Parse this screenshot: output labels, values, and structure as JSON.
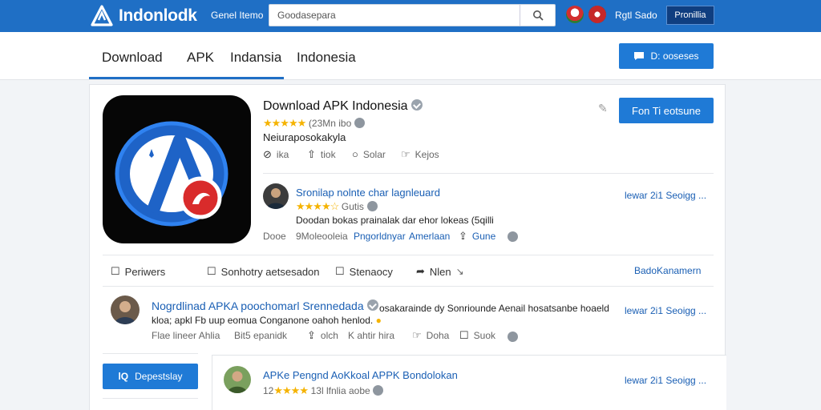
{
  "header": {
    "logo_text": "Indonlodk",
    "nav_label": "Genel Itemo",
    "search_placeholder": "Goodasepara",
    "signin_label": "Rgtl Sado",
    "cta_label": "Pronillia",
    "brand_color": "#1f6fc5"
  },
  "tabs": {
    "items": [
      "Download",
      "APK",
      "Indansia",
      "Indonesia"
    ],
    "action_label": "D: ooseses"
  },
  "app": {
    "title": "Download APK Indonesia",
    "rating_count": "(23Mn ibo",
    "description": "Neiuraposokakyla",
    "actions": [
      "ika",
      "tiok",
      "Solar",
      "Kejos"
    ],
    "download_label": "Fon Ti eotsune"
  },
  "reviewer1": {
    "name": "Sronilap nolnte char lagnleuard",
    "rating_text": "Gutis",
    "review": "Doodan bokas prainalak dar ehor lokeas (5qilli",
    "meta": [
      "Dooe",
      "9Moleooleia"
    ],
    "links": [
      "Pngorldnyar",
      "Amerlaan"
    ],
    "share": "Gune",
    "side_link": "lewar 2i1 Seoigg ..."
  },
  "actionbar": {
    "items": [
      "Periwers",
      "Sonhotry aetsesadon",
      "Stenaocy",
      "Nlen"
    ],
    "right_link": "BadoKanamern"
  },
  "reviewer2": {
    "name": "Nogrdlinad APKA poochomarl Srennedada",
    "text": "osakarainde dy Sonriounde Aenail hosatsanbe hoaeld",
    "text2": "kloa; apkl Fb uup eomua Conganone oahoh henlod.",
    "meta": [
      "Flae lineer Ahlia",
      "Bit5 epanidk",
      "olch",
      "K ahtir hira",
      "Doha",
      "Suok"
    ],
    "side_link": "lewar 2i1 Seoigg ..."
  },
  "sidebar": {
    "button_label": "Depestslay"
  },
  "reviewer3": {
    "name": "APKe Pengnd AoKkoal APPK Bondolokan",
    "rating_text": "13l lfnlia aobe",
    "rating_prefix": "12",
    "side_link": "lewar 2i1 Seoigg ..."
  }
}
